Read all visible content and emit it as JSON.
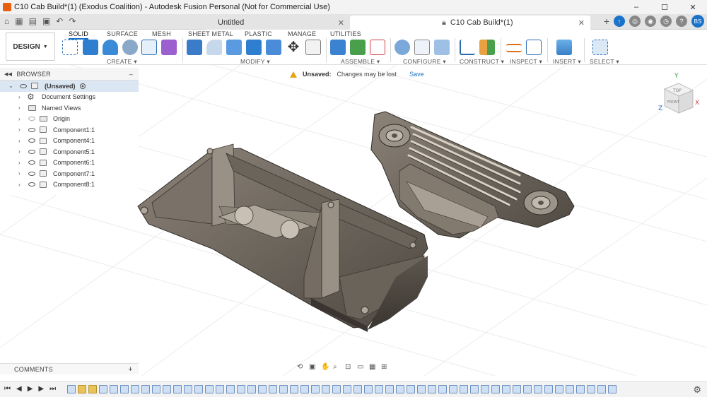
{
  "window": {
    "title": "C10 Cab Build*(1) (Exodus Coalition) - Autodesk Fusion Personal (Not for Commercial Use)",
    "controls": [
      "–",
      "☐",
      "✕"
    ]
  },
  "tabs": [
    {
      "label": "Untitled",
      "active": false
    },
    {
      "label": "C10 Cab Build*(1)",
      "active": true
    }
  ],
  "user": {
    "initials": "BS"
  },
  "toolbar": {
    "design_label": "DESIGN",
    "workspace_tabs": [
      "SOLID",
      "SURFACE",
      "MESH",
      "SHEET METAL",
      "PLASTIC",
      "MANAGE",
      "UTILITIES"
    ],
    "groups": [
      "CREATE",
      "MODIFY",
      "ASSEMBLE",
      "CONFIGURE",
      "CONSTRUCT",
      "INSPECT",
      "INSERT",
      "SELECT"
    ]
  },
  "browser": {
    "title": "BROWSER",
    "root": "(Unsaved)",
    "items": [
      {
        "label": "Document Settings"
      },
      {
        "label": "Named Views"
      },
      {
        "label": "Origin"
      },
      {
        "label": "Component1:1"
      },
      {
        "label": "Component4:1"
      },
      {
        "label": "Component5:1"
      },
      {
        "label": "Component6:1"
      },
      {
        "label": "Component7:1"
      },
      {
        "label": "Component8:1"
      }
    ]
  },
  "notice": {
    "status": "Unsaved:",
    "message": "Changes may be lost",
    "action": "Save"
  },
  "viewcube": {
    "top": "TOP",
    "front": "FRONT",
    "axes": [
      "Y",
      "X",
      "Z"
    ]
  },
  "comments": {
    "title": "COMMENTS"
  }
}
